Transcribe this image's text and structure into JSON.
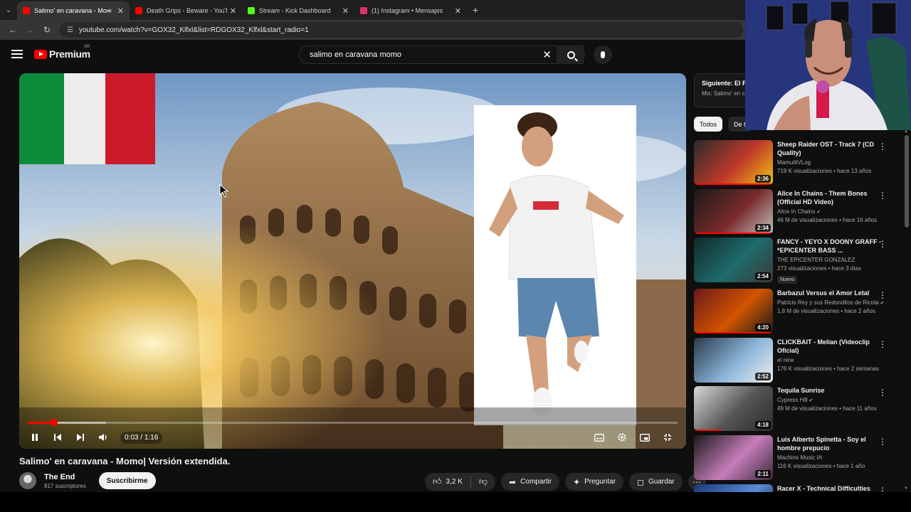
{
  "browser": {
    "tabs": [
      {
        "title": "Salimo' en caravana - Mom",
        "favicon_color": "#ff0000",
        "active": true,
        "audio": true
      },
      {
        "title": "Death Grips - Beware - YouTub",
        "favicon_color": "#ff0000",
        "active": false
      },
      {
        "title": "Stream - Kick Dashboard",
        "favicon_color": "#53fc18",
        "active": false
      },
      {
        "title": "(1) Instagram • Mensajes",
        "favicon_color": "#e1306c",
        "active": false
      }
    ],
    "url": "youtube.com/watch?v=GOX32_Klfxl&list=RDGOX32_Klfxl&start_radio=1"
  },
  "header": {
    "logo_text": "Premium",
    "country_code": "AR",
    "search_value": "salimo en caravana momo"
  },
  "player": {
    "time_current": "0:03",
    "time_separator": " / ",
    "time_total": "1:16",
    "progress_fraction": 0.04,
    "buffered_fraction": 0.12
  },
  "video": {
    "title": "Salimo' en caravana - Momo| Versión extendida.",
    "channel_name": "The End",
    "subscribers": "817 suscriptores",
    "subscribe_label": "Suscribirme",
    "likes": "3,2 K",
    "share_label": "Compartir",
    "ask_label": "Preguntar",
    "save_label": "Guardar"
  },
  "up_next": {
    "line1": "Siguiente: El P",
    "line2": "Mix: Salimo' en ca"
  },
  "chips": [
    "Todos",
    "De t"
  ],
  "recommendations": [
    {
      "title": "Sheep Raider OST - Track 7 (CD Quality)",
      "channel": "MamuttiVLog",
      "verified": false,
      "meta": "719 K visualizaciones • hace 13 años",
      "duration": "2:36",
      "badge": "",
      "thumb_colors": [
        "#2a2a2a",
        "#c0392b",
        "#f1c40f"
      ],
      "watched": 1.0
    },
    {
      "title": "Alice In Chains - Them Bones (Official HD Video)",
      "channel": "Alice In Chains",
      "verified": true,
      "meta": "46 M de visualizaciones • hace 16 años",
      "duration": "2:34",
      "badge": "",
      "thumb_colors": [
        "#1a1a1a",
        "#7a2a2a",
        "#c0c0c0"
      ],
      "watched": 1.0
    },
    {
      "title": "FANCY - YEYO X DOONY GRAFF - *EPICENTER BASS ...",
      "channel": "THE EPICENTER GONZALEZ",
      "verified": false,
      "meta": "273 visualizaciones • hace 3 días",
      "duration": "2:54",
      "badge": "Nuevo",
      "thumb_colors": [
        "#0f2a2a",
        "#1f6a6a",
        "#3a3a3a"
      ],
      "watched": 0.0
    },
    {
      "title": "Barbazul Versus el Amor Letal",
      "channel": "Patricio Rey y sus Redonditos de Ricota",
      "verified": true,
      "meta": "1,8 M de visualizaciones • hace 2 años",
      "duration": "4:20",
      "badge": "",
      "thumb_colors": [
        "#6a1a1a",
        "#d35400",
        "#1a1a1a"
      ],
      "watched": 1.0
    },
    {
      "title": "CLICKBAIT - Melian (Videoclip Oficial)",
      "channel": "el nine",
      "verified": false,
      "meta": "176 K visualizaciones • hace 2 semanas",
      "duration": "2:52",
      "badge": "",
      "thumb_colors": [
        "#2a3a4a",
        "#8ab4d8",
        "#f0f0f0"
      ],
      "watched": 0.0
    },
    {
      "title": "Tequila Sunrise",
      "channel": "Cypress Hill",
      "verified": true,
      "meta": "49 M de visualizaciones • hace 11 años",
      "duration": "4:18",
      "badge": "",
      "thumb_colors": [
        "#d8d8d8",
        "#555555",
        "#2a2a2a"
      ],
      "watched": 0.35
    },
    {
      "title": "Luis Alberto Spinetta - Soy el hombre prepucio",
      "channel": "Machine Music IA",
      "verified": false,
      "meta": "116 K visualizaciones • hace 1 año",
      "duration": "2:11",
      "badge": "",
      "thumb_colors": [
        "#1a1a1a",
        "#c77dba",
        "#3a2a3a"
      ],
      "watched": 0.0
    },
    {
      "title": "Racer X - Technical Difficulties",
      "channel": "",
      "verified": false,
      "meta": "",
      "duration": "",
      "badge": "",
      "thumb_colors": [
        "#1a3a7a",
        "#5a8ad8",
        "#0a0a0a"
      ],
      "watched": 0.0
    }
  ],
  "colors": {
    "accent": "#ff0000",
    "background": "#0f0f0f",
    "chip_active": "#f1f1f1"
  }
}
